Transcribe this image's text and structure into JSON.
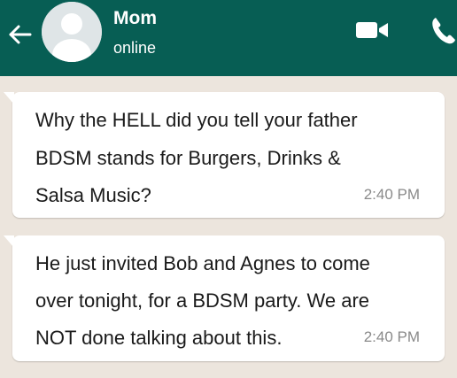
{
  "header": {
    "contact_name": "Mom",
    "status": "online",
    "back_icon": "arrow-left-icon",
    "video_icon": "video-camera-icon",
    "call_icon": "phone-icon",
    "avatar_icon": "default-avatar-icon",
    "bar_color": "#075e54"
  },
  "chat": {
    "background_color": "#ece5dd",
    "bubble_color": "#ffffff",
    "messages": [
      {
        "lines": [
          "Why the HELL did you tell your father",
          "BDSM stands for Burgers, Drinks &",
          "Salsa Music?"
        ],
        "time": "2:40 PM"
      },
      {
        "lines": [
          "He just invited Bob and Agnes to come",
          "over tonight, for a BDSM party. We are",
          "NOT done talking about this."
        ],
        "time": "2:40 PM"
      }
    ]
  }
}
